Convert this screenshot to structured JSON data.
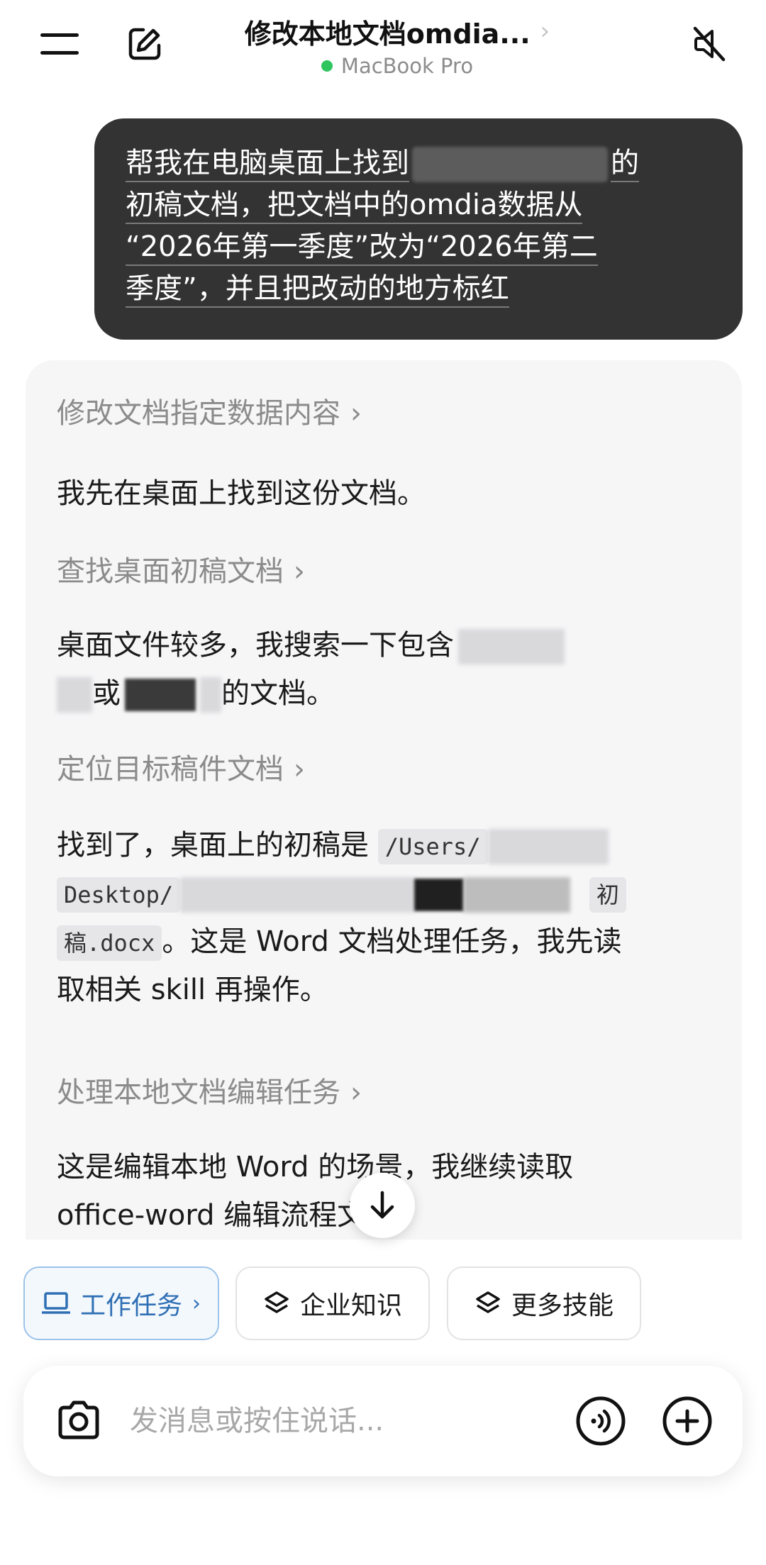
{
  "header": {
    "title": "修改本地文档omdia...",
    "device": "MacBook Pro"
  },
  "user_message": {
    "line1_pre": "帮我在电脑桌面上找到",
    "line1_post": "的",
    "line2": "初稿文档，把文档中的omdia数据从",
    "line3": "“2026年第一季度”改为“2026年第二",
    "line4": "季度”，并且把改动的地方标红"
  },
  "assistant": {
    "step1": "修改文档指定数据内容",
    "para1": "我先在桌面上找到这份文档。",
    "step2": "查找桌面初稿文档",
    "para2_line1": "桌面文件较多，我搜索一下包含",
    "para2_mid": "或",
    "para2_end": "的文档。",
    "step3": "定位目标稿件文档",
    "para3_line1_pre": "找到了，桌面上的初稿是",
    "para3_code1": "/Users/",
    "para3_code2": "Desktop/",
    "para3_code3": "初",
    "para3_code4": "稿.docx",
    "para3_line3_post": "。这是 Word 文档处理任务，我先读",
    "para3_line4": "取相关 skill 再操作。",
    "step4": "处理本地文档编辑任务",
    "para4_line1": "这是编辑本地 Word 的场景，我继续读取",
    "para4_line2": "office-word 编辑流程文档。"
  },
  "chips": {
    "work": "工作任务",
    "knowledge": "企业知识",
    "skills": "更多技能"
  },
  "input": {
    "placeholder": "发消息或按住说话..."
  },
  "colors": {
    "user_bubble": "#333333",
    "status_online": "#2fc55e",
    "chip_active": "#2f6fb4"
  }
}
